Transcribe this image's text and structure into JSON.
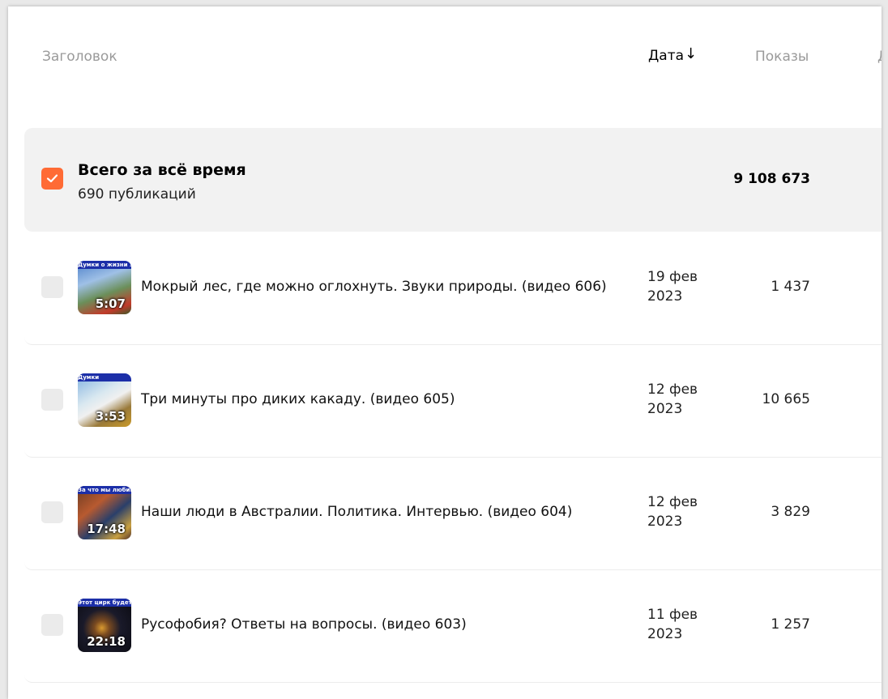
{
  "table": {
    "columns": {
      "title": "Заголовок",
      "date": "Дата",
      "date_sort_arrow": "↓",
      "views": "Показы",
      "edge": "Д"
    },
    "total": {
      "checked": true,
      "title": "Всего за всё время",
      "subtitle": "690 публикаций",
      "views": "9 108 673"
    },
    "rows": [
      {
        "thumb_caption": "Думки о жизни за океаном",
        "duration": "5:07",
        "title": "Мокрый лес, где можно оглохнуть. Звуки природы. (видео 606)",
        "date_line1": "19 фев",
        "date_line2": "2023",
        "views": "1 437"
      },
      {
        "thumb_caption": "Думки",
        "duration": "3:53",
        "title": "Три минуты про диких какаду. (видео 605)",
        "date_line1": "12 фев",
        "date_line2": "2023",
        "views": "10 665"
      },
      {
        "thumb_caption": "За что мы любим",
        "duration": "17:48",
        "title": "Наши люди в Австралии. Политика. Интервью. (видео 604)",
        "date_line1": "12 фев",
        "date_line2": "2023",
        "views": "3 829"
      },
      {
        "thumb_caption": "Этот цирк будет со",
        "duration": "22:18",
        "title": "Русофобия? Ответы на вопросы. (видео 603)",
        "date_line1": "11 фев",
        "date_line2": "2023",
        "views": "1 257"
      }
    ]
  },
  "colors": {
    "accent": "#ff6b35",
    "checkbox_empty": "#ebebeb",
    "total_background": "#f2f2f2",
    "header_muted": "#9a9a9a"
  }
}
